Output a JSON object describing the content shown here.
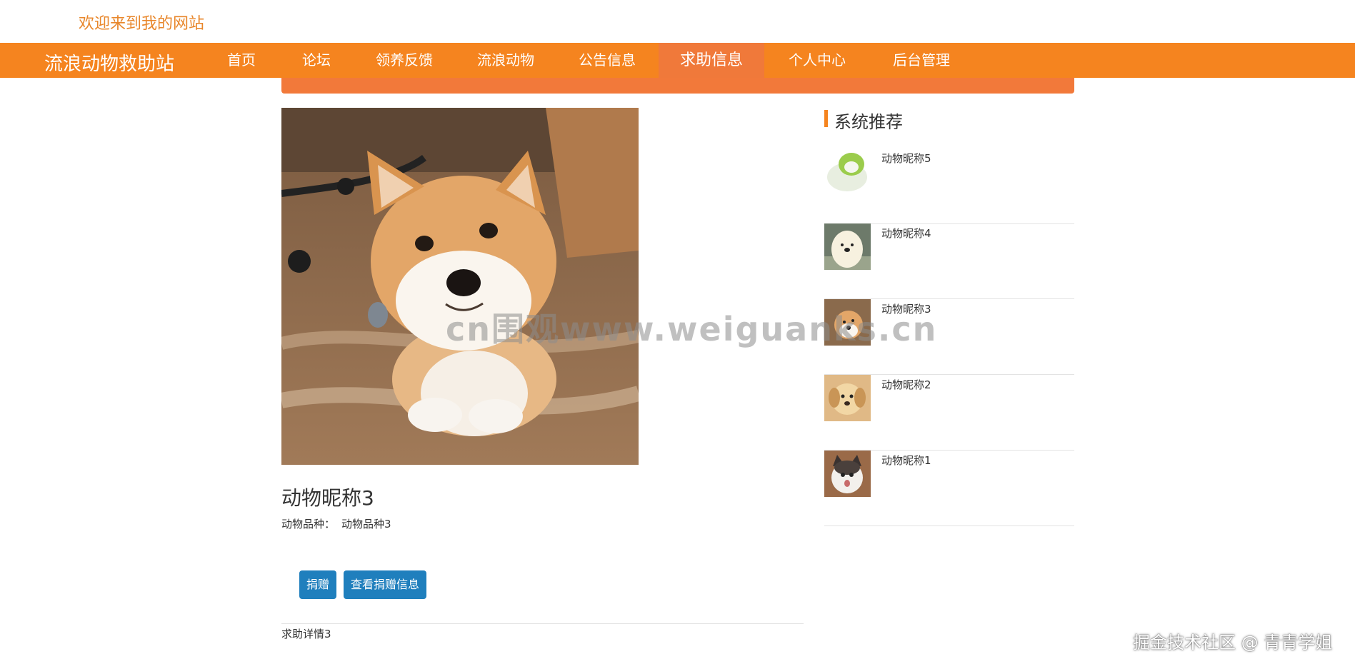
{
  "header": {
    "welcome": "欢迎来到我的网站"
  },
  "nav": {
    "brand": "流浪动物救助站",
    "items": [
      {
        "label": "首页"
      },
      {
        "label": "论坛"
      },
      {
        "label": "领养反馈"
      },
      {
        "label": "流浪动物"
      },
      {
        "label": "公告信息"
      },
      {
        "label": "求助信息",
        "active": true
      },
      {
        "label": "个人中心"
      },
      {
        "label": "后台管理"
      }
    ]
  },
  "detail": {
    "title": "动物昵称3",
    "breed_label": "动物品种：",
    "breed_value": "动物品种3",
    "buttons": {
      "donate": "捐赠",
      "view_donations": "查看捐赠信息"
    },
    "help_detail": "求助详情3"
  },
  "sidebar": {
    "heading": "系统推荐",
    "items": [
      {
        "name": "动物昵称5"
      },
      {
        "name": "动物昵称4"
      },
      {
        "name": "动物昵称3"
      },
      {
        "name": "动物昵称2"
      },
      {
        "name": "动物昵称1"
      }
    ]
  },
  "overlay": {
    "watermark": "cn围观www.weiguanks.cn",
    "credit": "掘金技术社区 @ 青青学姐"
  },
  "colors": {
    "nav_bg": "#f5841f",
    "nav_active": "#f0793a",
    "button": "#1f7fbd",
    "welcome": "#e8862a"
  }
}
